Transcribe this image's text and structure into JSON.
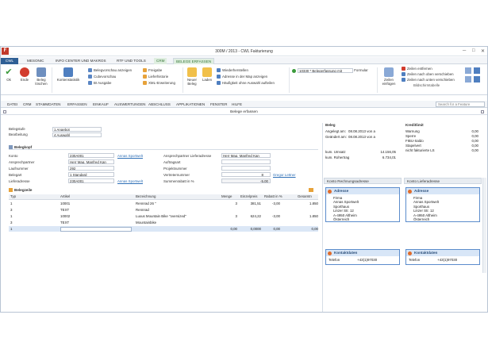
{
  "window": {
    "title": "300M / 2013 - CWL Fakturierung",
    "app_badge": "F",
    "btn_min": "─",
    "btn_max": "□",
    "btn_close": "✕"
  },
  "ribbon_tabs": [
    "CWL",
    "MESONIC",
    "INFO CENTER UND MAKROS",
    "RTF UND TOOLS",
    "CRM",
    "BELEGE ERFASSEN"
  ],
  "ribbon": {
    "ok": "Ok",
    "ende": "Ende",
    "beleg_loschen": "Beleg löschen",
    "kontenstatistik": "Kontenstatistik",
    "belegvorschau": "Belegvorschau anzeigen",
    "freigabe": "Freigabe",
    "cubevorschau": "Cubevorschau",
    "lieferhistorie": "Lieferhistorie",
    "bi_ausgabe": "BI Ausgabe",
    "xml_erweiterung": "XML-Erweiterung",
    "neuer_beleg": "Neuer Beleg",
    "laden": "Laden",
    "wiederherstellen": "Wiederherstellen",
    "adresse_map": "Adresse in der Map anzeigen",
    "haeufigkeit": "Häufigkeit ohne Auswahl aufteilen",
    "belegfassung_combo": "10330 * Belegerfassung mit",
    "formular": "Formular",
    "zeilen_einfuegen": "Zeilen einfügen",
    "zeilen_entfernen": "Zeilen entfernen",
    "zeilen_oben": "Zeilen nach oben verschieben",
    "zeilen_unten": "Zeilen nach unten verschieben",
    "bildschirmtabelle": "Bildschirmtabelle"
  },
  "menu": {
    "items": [
      "DATEI",
      "CRM",
      "STAMMDATEN",
      "ERFASSEN",
      "EINKAUF",
      "AUSWERTUNGEN",
      "ABSCHLUSS",
      "APPLIKATIONEN",
      "FENSTER",
      "HILFE"
    ],
    "search_placeholder": "Search for a Feature"
  },
  "doc": {
    "title": "Belege erfassen"
  },
  "top": {
    "belegstufe_label": "Belegstufe",
    "belegstufe_value": "1 Angebot",
    "bearbeitung_label": "Bearbeitung",
    "bearbeitung_value": "4 Auswahl"
  },
  "belegkopf": {
    "title": "Belegkopf",
    "konto_label": "Konto",
    "konto_value": "230A001",
    "konto_link": "Annas Sportwelt",
    "ansprech_label": "Ansprechpartner",
    "ansprech_value": "Herr Mag. Manfred Kan",
    "laufnummer_label": "Laufnummer",
    "laufnummer_value": "292",
    "belegart_label": "Belegart",
    "belegart_value": "1 Standard",
    "lieferadresse_label": "Lieferadresse",
    "lieferadresse_value": "230A001",
    "lieferadresse_link": "Annas Sportwelt",
    "ap_liefer_label": "Ansprechpartner Lieferadresse",
    "ap_liefer_value": "Herr Mag. Manfred Kan",
    "auftragsart_label": "Auftragsart",
    "projektnummer_label": "Projektnummer",
    "vertreternummer_label": "Vertreternummer",
    "vertreternummer_value": "8",
    "vertreter_link": "Gregor Lettner",
    "summenrabatt_label": "Summenrabatt in %",
    "summenrabatt_value": "-5,00"
  },
  "belegzeile": {
    "title": "Belegzeile",
    "headers": [
      "Typ",
      "Artikel",
      "Bezeichnung",
      "Menge",
      "Einzelpreis",
      "Rabatt in %",
      "Gesamtn"
    ],
    "rows": [
      [
        "1",
        "10001",
        "Rennrad 26 \"",
        "3",
        "381,51",
        "-3,00",
        "1.850"
      ],
      [
        "3",
        "TEXT",
        "Rennrad",
        "",
        "",
        "",
        ""
      ],
      [
        "1",
        "10002",
        "Luxus Mountain Bike \"oversized\"",
        "3",
        "624,22",
        "-3,00",
        "1.850"
      ],
      [
        "3",
        "TEXT",
        "Mountainbike",
        "",
        "",
        "",
        ""
      ],
      [
        "1",
        "",
        "",
        "0,00",
        "0,0000",
        "0,00",
        "0,00"
      ]
    ]
  },
  "beleg_info": {
    "title": "Beleg",
    "angelegt_label": "Angelegt am:",
    "angelegt_value": "08.08.2013  von  a",
    "geaendert_label": "Geändert am:",
    "geaendert_value": "08.08.2013  von  a",
    "umsatz_label": "kum. Umsatz",
    "umsatz_value": "14.156,05",
    "rohertrag_label": "kum. Rohertrag",
    "rohertrag_value": "6.734,01"
  },
  "kreditlimit": {
    "title": "Kreditlimit",
    "rows": [
      [
        "Warnung",
        "0,00"
      ],
      [
        "Sperre",
        "0,00"
      ],
      [
        "FIBU-Saldo",
        "0,00"
      ],
      [
        "Stapelvert",
        "0,00"
      ],
      [
        "nicht fakturierte LS",
        "0,00"
      ]
    ]
  },
  "rechnungsadresse": {
    "panel_title": "Konto Rechnungsadresse",
    "card_title": "Adresse",
    "lines": [
      "Firma",
      "Annas Sportwelt",
      "Sporthaus",
      "Linzer Str. 12",
      "A-4950 Altheim",
      "Österreich"
    ],
    "kontakt_title": "Kontaktdaten",
    "telefon_label": "Telefon",
    "telefon_value": "+43(1)97030"
  },
  "lieferadresse": {
    "panel_title": "Konto Lieferadresse",
    "card_title": "Adresse",
    "lines": [
      "Firma",
      "Annas Sportwelt",
      "Sporthaus",
      "Linzer Str. 12",
      "A-4950 Altheim",
      "Österreich"
    ],
    "kontakt_title": "Kontaktdaten",
    "telefon_label": "Telefon",
    "telefon_value": "+43(1)97030"
  }
}
